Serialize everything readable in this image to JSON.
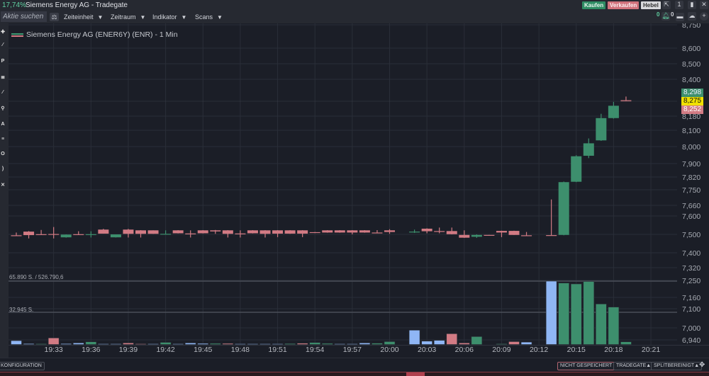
{
  "titlebar": {
    "change_pct": "17,74%",
    "title": "Siemens Energy AG - Tradegate",
    "buy_label": "Kaufen",
    "sell_label": "Verkaufen",
    "lever_label": "Hebel",
    "window_count": "1"
  },
  "toolbar": {
    "search_placeholder": "Aktie suchen",
    "menus": [
      "Zeiteinheit",
      "Zeitraum",
      "Indikator",
      "Scans"
    ],
    "alert_count": "0",
    "notif_count": "0"
  },
  "chart": {
    "legend": "Siemens Energy AG (ENER6Y) (ENR) - 1 Min",
    "volume_max_label": "65.890 S. / 526.790,6",
    "volume_mid_label": "32.945 S.",
    "price_ticks": [
      "8,750",
      "8,600",
      "8,500",
      "8,400",
      "8,180",
      "8,100",
      "8,000",
      "7,900",
      "7,820",
      "7,750",
      "7,660",
      "7,600",
      "7,500",
      "7,400",
      "7,320",
      "7,250",
      "7,160",
      "7,100",
      "7,000",
      "6,940"
    ],
    "time_ticks": [
      "19:33",
      "19:36",
      "19:39",
      "19:42",
      "19:45",
      "19:48",
      "19:51",
      "19:54",
      "19:57",
      "20:00",
      "20:03",
      "20:06",
      "20:09",
      "20:12",
      "20:15",
      "20:18",
      "20:21"
    ],
    "ask": "8,298",
    "last": "8,275",
    "bid": "8,252",
    "colors": {
      "up": "#3d8f6d",
      "down": "#d27b84",
      "flat": "#8fb6f5",
      "last": "#f0e000"
    }
  },
  "chart_data": {
    "type": "candlestick",
    "title": "Siemens Energy AG (ENER6Y) (ENR) - 1 Min",
    "ylim": [
      6.94,
      8.75
    ],
    "candles_ohlc": [
      [
        "19:30",
        7.495,
        7.51,
        7.494,
        7.494
      ],
      [
        "19:31",
        7.515,
        7.518,
        7.478,
        7.496
      ],
      [
        "19:32",
        7.501,
        7.524,
        7.5,
        7.5
      ],
      [
        "19:33",
        7.502,
        7.54,
        7.478,
        7.5
      ],
      [
        "19:34",
        7.484,
        7.5,
        7.482,
        7.499
      ],
      [
        "19:35",
        7.501,
        7.517,
        7.5,
        7.5
      ],
      [
        "19:36",
        7.5,
        7.517,
        7.483,
        7.501
      ],
      [
        "19:37",
        7.526,
        7.53,
        7.504,
        7.504
      ],
      [
        "19:38",
        7.484,
        7.5,
        7.483,
        7.5
      ],
      [
        "19:39",
        7.526,
        7.53,
        7.483,
        7.503
      ],
      [
        "19:40",
        7.522,
        7.523,
        7.483,
        7.503
      ],
      [
        "19:41",
        7.522,
        7.522,
        7.503,
        7.503
      ],
      [
        "19:42",
        7.502,
        7.522,
        7.502,
        7.503
      ],
      [
        "19:43",
        7.522,
        7.523,
        7.505,
        7.506
      ],
      [
        "19:44",
        7.505,
        7.522,
        7.483,
        7.503
      ],
      [
        "19:45",
        7.522,
        7.523,
        7.505,
        7.506
      ],
      [
        "19:46",
        7.522,
        7.524,
        7.503,
        7.516
      ],
      [
        "19:47",
        7.522,
        7.523,
        7.483,
        7.503
      ],
      [
        "19:48",
        7.505,
        7.522,
        7.483,
        7.503
      ],
      [
        "19:49",
        7.522,
        7.523,
        7.505,
        7.506
      ],
      [
        "19:50",
        7.522,
        7.523,
        7.483,
        7.503
      ],
      [
        "19:51",
        7.522,
        7.523,
        7.485,
        7.504
      ],
      [
        "19:52",
        7.522,
        7.523,
        7.503,
        7.504
      ],
      [
        "19:53",
        7.522,
        7.523,
        7.485,
        7.504
      ],
      [
        "19:54",
        7.512,
        7.513,
        7.507,
        7.508
      ],
      [
        "19:55",
        7.522,
        7.523,
        7.509,
        7.51
      ],
      [
        "19:56",
        7.522,
        7.523,
        7.509,
        7.51
      ],
      [
        "19:57",
        7.522,
        7.523,
        7.5,
        7.51
      ],
      [
        "19:58",
        7.522,
        7.523,
        7.509,
        7.51
      ],
      [
        "19:59",
        7.51,
        7.523,
        7.508,
        7.509
      ],
      [
        "20:00",
        7.522,
        7.528,
        7.503,
        7.513
      ],
      [
        "20:02",
        7.513,
        7.526,
        7.508,
        7.515
      ],
      [
        "20:03",
        7.531,
        7.533,
        7.506,
        7.517
      ],
      [
        "20:04",
        7.518,
        7.537,
        7.506,
        7.517
      ],
      [
        "20:05",
        7.518,
        7.537,
        7.5,
        7.501
      ],
      [
        "20:06",
        7.497,
        7.522,
        7.481,
        7.482
      ],
      [
        "20:07",
        7.487,
        7.5,
        7.481,
        7.497
      ],
      [
        "20:08",
        7.497,
        7.497,
        7.493,
        7.493
      ],
      [
        "20:09",
        7.519,
        7.52,
        7.485,
        7.51
      ],
      [
        "20:10",
        7.519,
        7.52,
        7.497,
        7.497
      ],
      [
        "20:11",
        7.495,
        7.513,
        7.494,
        7.494
      ],
      [
        "20:13",
        7.496,
        7.694,
        7.495,
        7.495
      ],
      [
        "20:14",
        7.497,
        7.795,
        7.495,
        7.792
      ],
      [
        "20:15",
        7.794,
        7.949,
        7.792,
        7.943
      ],
      [
        "20:16",
        7.946,
        8.05,
        7.932,
        8.02
      ],
      [
        "20:17",
        8.038,
        8.194,
        8.035,
        8.169
      ],
      [
        "20:18",
        8.169,
        8.265,
        8.166,
        8.242
      ],
      [
        "20:19",
        8.275,
        8.297,
        8.268,
        8.268
      ]
    ],
    "volume": {
      "max": 65890,
      "bars": [
        [
          "19:30",
          4000,
          "flat"
        ],
        [
          "19:31",
          900,
          "flat"
        ],
        [
          "19:32",
          300,
          "up"
        ],
        [
          "19:33",
          6800,
          "down"
        ],
        [
          "19:34",
          900,
          "flat"
        ],
        [
          "19:35",
          1600,
          "flat"
        ],
        [
          "19:36",
          2800,
          "up"
        ],
        [
          "19:37",
          500,
          "flat"
        ],
        [
          "19:38",
          700,
          "flat"
        ],
        [
          "19:39",
          1600,
          "down"
        ],
        [
          "19:40",
          700,
          "down"
        ],
        [
          "19:41",
          300,
          "flat"
        ],
        [
          "19:42",
          2200,
          "up"
        ],
        [
          "19:43",
          300,
          "flat"
        ],
        [
          "19:44",
          1600,
          "flat"
        ],
        [
          "19:45",
          1100,
          "flat"
        ],
        [
          "19:46",
          1100,
          "up"
        ],
        [
          "19:47",
          1100,
          "down"
        ],
        [
          "19:48",
          300,
          "flat"
        ],
        [
          "19:49",
          200,
          "flat"
        ],
        [
          "19:50",
          500,
          "flat"
        ],
        [
          "19:51",
          500,
          "flat"
        ],
        [
          "19:52",
          900,
          "up"
        ],
        [
          "19:53",
          1300,
          "down"
        ],
        [
          "19:54",
          2000,
          "up"
        ],
        [
          "19:55",
          1100,
          "up"
        ],
        [
          "19:56",
          200,
          "flat"
        ],
        [
          "19:57",
          700,
          "flat"
        ],
        [
          "19:58",
          1600,
          "flat"
        ],
        [
          "19:59",
          1300,
          "up"
        ],
        [
          "20:00",
          3000,
          "up"
        ],
        [
          "20:02",
          14900,
          "flat"
        ],
        [
          "20:03",
          3500,
          "flat"
        ],
        [
          "20:04",
          4300,
          "flat"
        ],
        [
          "20:05",
          11200,
          "down"
        ],
        [
          "20:06",
          1600,
          "down"
        ],
        [
          "20:07",
          8200,
          "up"
        ],
        [
          "20:09",
          300,
          "up"
        ],
        [
          "20:10",
          3000,
          "down"
        ],
        [
          "20:11",
          2500,
          "flat"
        ],
        [
          "20:13",
          65890,
          "flat"
        ],
        [
          "20:14",
          63900,
          "up"
        ],
        [
          "20:15",
          62950,
          "up"
        ],
        [
          "20:16",
          65500,
          "up"
        ],
        [
          "20:17",
          42100,
          "up"
        ],
        [
          "20:18",
          38900,
          "up"
        ],
        [
          "20:19",
          2800,
          "up"
        ]
      ]
    }
  },
  "bottombar": {
    "config_label": "KONFIGURATION",
    "not_saved_label": "NICHT GESPEICHERT",
    "exchange_label": "TRADEGATE",
    "split_label": "SPLITBEREINIGT"
  }
}
